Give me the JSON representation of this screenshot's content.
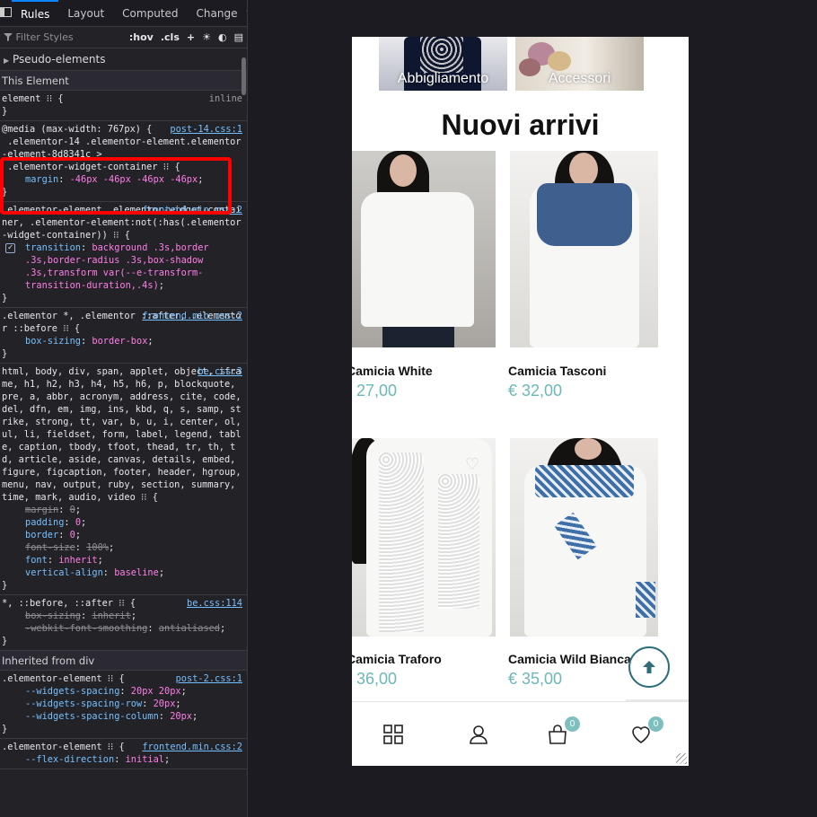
{
  "devtools": {
    "tabs": [
      "Rules",
      "Layout",
      "Computed",
      "Change"
    ],
    "active_tab": "Rules",
    "toolbar": {
      "filter_placeholder": "Filter Styles",
      "hov": ":hov",
      "cls": ".cls"
    },
    "pseudo_elements": "Pseudo-elements",
    "this_element": "This Element",
    "inherited_from": "Inherited from div",
    "rules": [
      {
        "selector": "element ⁝⁝ {",
        "source": "inline",
        "decls": [],
        "close": "}"
      },
      {
        "selector": "@media (max-width: 767px) {\n .elementor-14 .elementor-element.elementor-element-8d8341c >\n .elementor-widget-container ⁝⁝ {",
        "source": "post-14.css:1",
        "decls": [
          {
            "prop": "margin",
            "val": "-46px -46px -46px -46px",
            "off": false
          }
        ],
        "close": "}"
      },
      {
        "selector": ".elementor-element .elementor-widget-container, .elementor-element:not(:has(.elementor-widget-container)) ⁝⁝ {",
        "source": "frontend.min.css:2",
        "decls": [
          {
            "prop": "transition",
            "val": "background .3s,border .3s,border-radius .3s,box-shadow .3s,transform var(--e-transform-transition-duration,.4s)",
            "off": false
          }
        ],
        "close": "}"
      },
      {
        "selector": ".elementor *, .elementor ::after, .elementor ::before ⁝⁝ {",
        "source": "frontend.min.css:2",
        "decls": [
          {
            "prop": "box-sizing",
            "val": "border-box",
            "off": false
          }
        ],
        "close": "}"
      },
      {
        "selector": "html, body, div, span, applet, object, iframe, h1, h2, h3, h4, h5, h6, p, blockquote, pre, a, abbr, acronym, address, cite, code, del, dfn, em, img, ins, kbd, q, s, samp, strike, strong, tt, var, b, u, i, center, ol, ul, li, fieldset, form, label, legend, table, caption, tbody, tfoot, thead, tr, th, td, article, aside, canvas, details, embed, figure, figcaption, footer, header, hgroup, menu, nav, output, ruby, section, summary, time, mark, audio, video ⁝⁝ {",
        "source": "be.css:3",
        "decls": [
          {
            "prop": "margin",
            "val": "0",
            "off": true
          },
          {
            "prop": "padding",
            "val": "0",
            "off": false
          },
          {
            "prop": "border",
            "val": "0",
            "off": false
          },
          {
            "prop": "font-size",
            "val": "100%",
            "off": true
          },
          {
            "prop": "font",
            "val": "inherit",
            "off": false
          },
          {
            "prop": "vertical-align",
            "val": "baseline",
            "off": false
          }
        ],
        "close": "}"
      },
      {
        "selector": "*, ::before, ::after ⁝⁝ {",
        "source": "be.css:114",
        "decls": [
          {
            "prop": "box-sizing",
            "val": "inherit",
            "off": true
          },
          {
            "prop": "-webkit-font-smoothing",
            "val": "antialiased",
            "off": true
          }
        ],
        "close": "}"
      }
    ],
    "inherited_rules": [
      {
        "selector": ".elementor-element ⁝⁝ {",
        "source": "post-2.css:1",
        "decls": [
          {
            "prop": "--widgets-spacing",
            "val": "20px 20px",
            "off": false
          },
          {
            "prop": "--widgets-spacing-row",
            "val": "20px",
            "off": false
          },
          {
            "prop": "--widgets-spacing-column",
            "val": "20px",
            "off": false
          }
        ],
        "close": "}"
      },
      {
        "selector": ".elementor-element ⁝⁝ {",
        "source": "frontend.min.css:2",
        "decls": [
          {
            "prop": "--flex-direction",
            "val": "initial",
            "off": false
          }
        ],
        "close": ""
      }
    ]
  },
  "page": {
    "categories": [
      "Abbigliamento",
      "Accessori"
    ],
    "section_title": "Nuovi arrivi",
    "products": [
      {
        "name": "Camicia White",
        "price": "€ 27,00"
      },
      {
        "name": "Camicia Tasconi",
        "price": "€ 32,00"
      },
      {
        "name": "Camicia Traforo",
        "price": "€ 36,00"
      },
      {
        "name": "Camicia Wild Bianca",
        "price": "€ 35,00"
      }
    ],
    "cart_count": "0",
    "wishlist_count": "0"
  },
  "colors": {
    "accent": "#6cb8b8",
    "highlight": "#ff0000",
    "devtools_bg": "#232327"
  }
}
